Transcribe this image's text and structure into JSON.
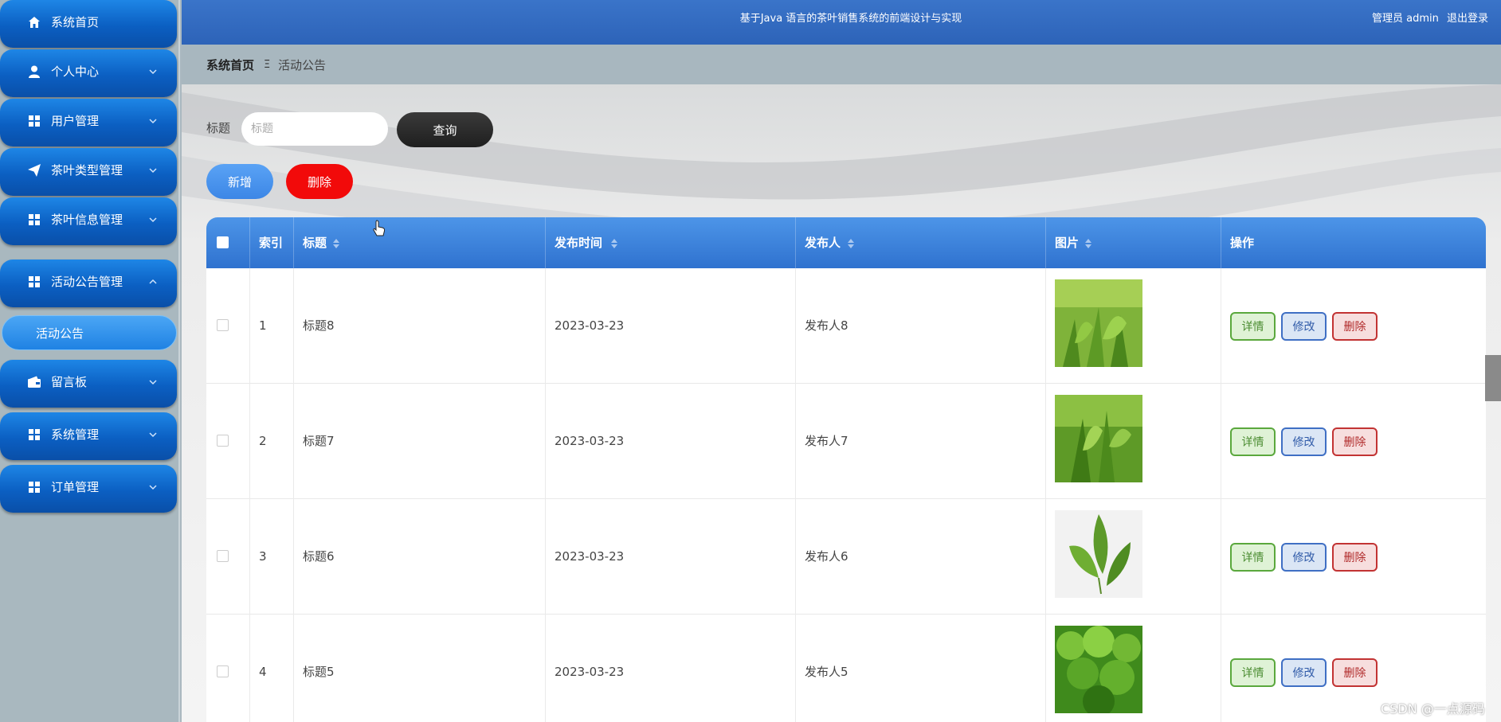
{
  "app": {
    "title": "基于Java 语言的茶叶销售系统的前端设计与实现",
    "user_label": "管理员 admin",
    "logout_label": "退出登录"
  },
  "sidebar": {
    "items": [
      {
        "label": "系统首页",
        "icon": "home-icon",
        "expandable": false
      },
      {
        "label": "个人中心",
        "icon": "user-icon",
        "expandable": true
      },
      {
        "label": "用户管理",
        "icon": "grid-icon",
        "expandable": true
      },
      {
        "label": "茶叶类型管理",
        "icon": "send-icon",
        "expandable": true
      },
      {
        "label": "茶叶信息管理",
        "icon": "grid-icon",
        "expandable": true
      },
      {
        "label": "活动公告管理",
        "icon": "grid-icon",
        "expandable": true,
        "expanded": true
      },
      {
        "label": "留言板",
        "icon": "wallet-icon",
        "expandable": true
      },
      {
        "label": "系统管理",
        "icon": "grid-icon",
        "expandable": true
      },
      {
        "label": "订单管理",
        "icon": "grid-icon",
        "expandable": true
      }
    ],
    "sub_item": "活动公告"
  },
  "breadcrumb": {
    "home": "系统首页",
    "separator": "Ξ",
    "current": "活动公告"
  },
  "search": {
    "label": "标题",
    "placeholder": "标题",
    "query_button": "查询"
  },
  "toolbar": {
    "add_label": "新增",
    "delete_label": "删除"
  },
  "table": {
    "columns": [
      "索引",
      "标题",
      "发布时间",
      "发布人",
      "图片",
      "操作"
    ],
    "rows": [
      {
        "index": "1",
        "title": "标题8",
        "date": "2023-03-23",
        "publisher": "发布人8"
      },
      {
        "index": "2",
        "title": "标题7",
        "date": "2023-03-23",
        "publisher": "发布人7"
      },
      {
        "index": "3",
        "title": "标题6",
        "date": "2023-03-23",
        "publisher": "发布人6"
      },
      {
        "index": "4",
        "title": "标题5",
        "date": "2023-03-23",
        "publisher": "发布人5"
      }
    ],
    "actions": {
      "detail": "详情",
      "edit": "修改",
      "delete": "删除"
    }
  },
  "watermark": "CSDN @一点源码",
  "colors": {
    "nav_blue": "#0b5fc2",
    "header_blue": "#2d63b8",
    "delete_red": "#f20a0a",
    "query_dark": "#1f1f1f"
  }
}
